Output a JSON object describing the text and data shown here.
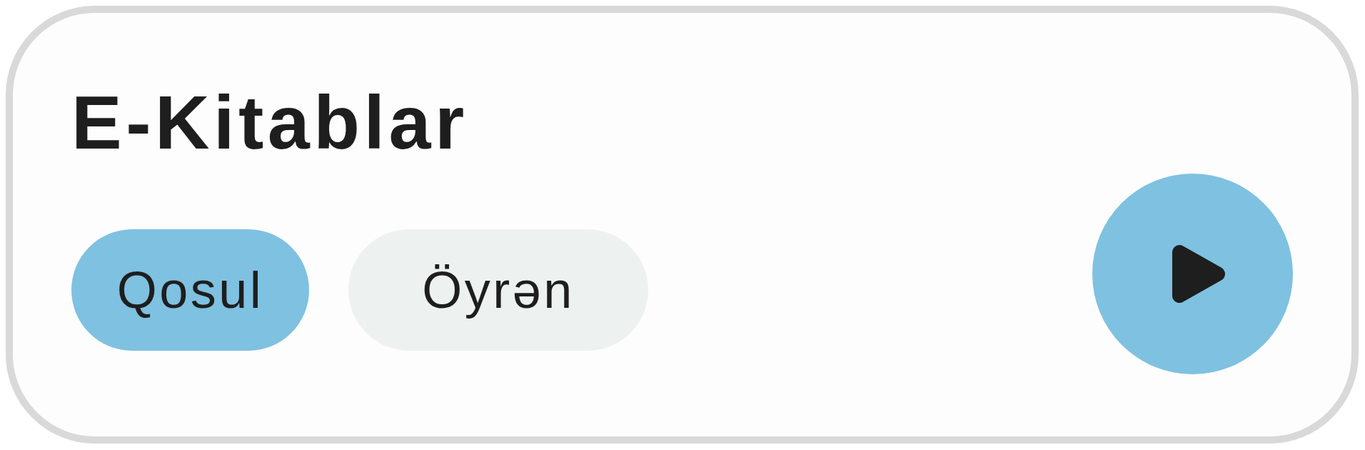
{
  "title": "E-Kitablar",
  "buttons": [
    {
      "label": "Qosul",
      "kind": "primary"
    },
    {
      "label": "Öyrən",
      "kind": "secondary"
    }
  ]
}
